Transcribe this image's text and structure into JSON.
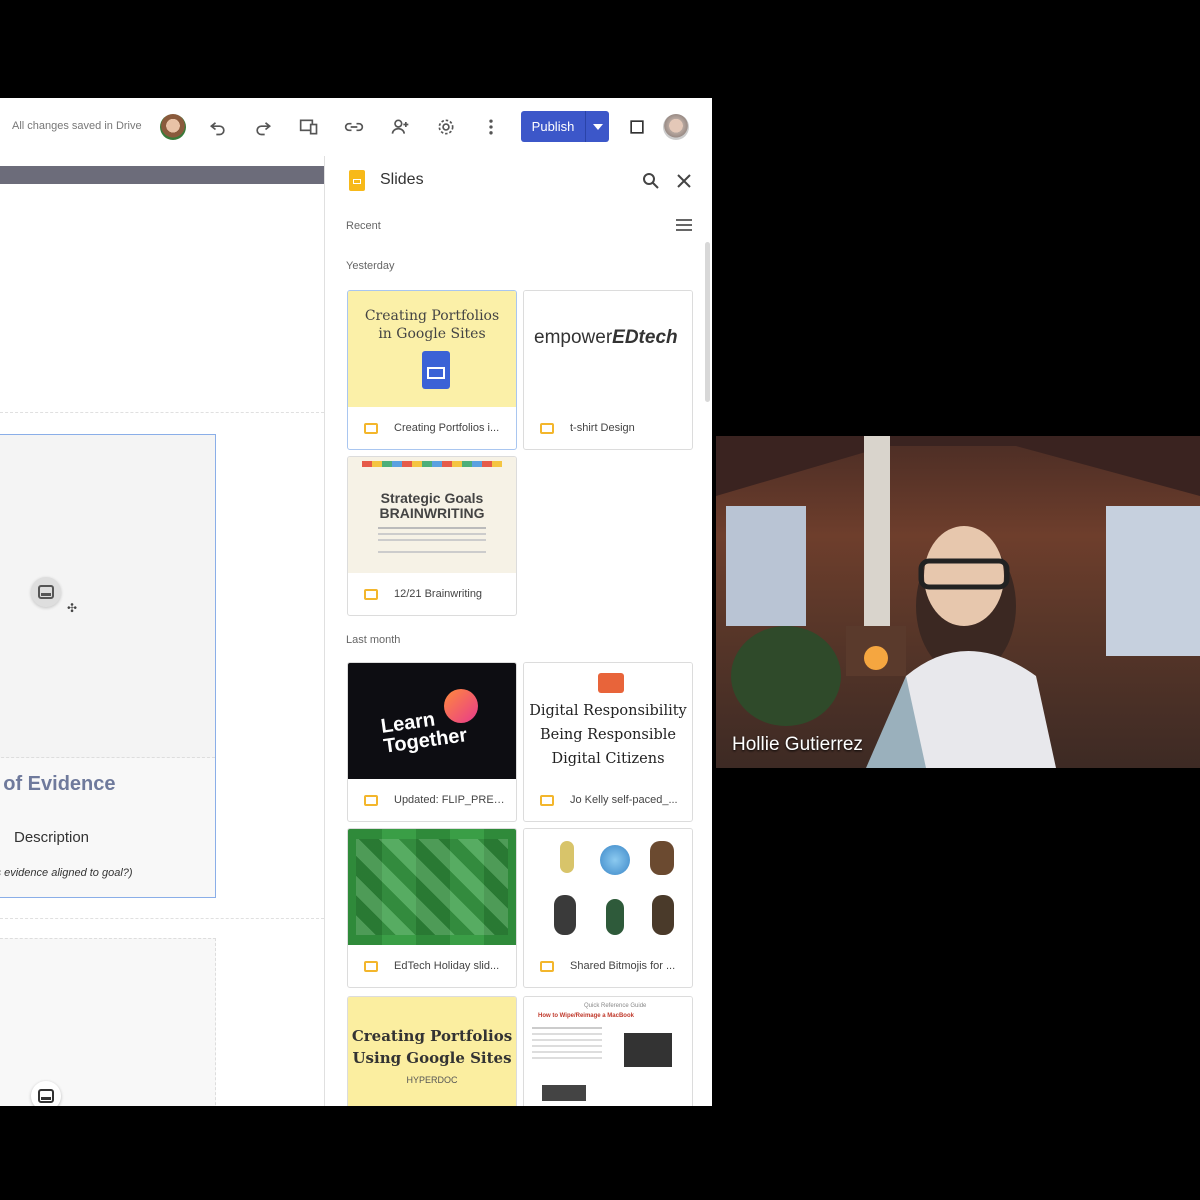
{
  "toolbar": {
    "status": "All changes saved in Drive",
    "publish_label": "Publish"
  },
  "editor": {
    "card_title": "le of Evidence",
    "card_description": "Description",
    "card_question": "his evidence aligned to goal?)"
  },
  "panel": {
    "title": "Slides",
    "recent_label": "Recent",
    "sections": {
      "yesterday": "Yesterday",
      "last_month": "Last month"
    },
    "files": [
      {
        "name": "Creating Portfolios i...",
        "thumb_title": "Creating Portfolios in Google Sites"
      },
      {
        "name": "t-shirt Design",
        "thumb_text_a": "empower",
        "thumb_text_b": "EDtech"
      },
      {
        "name": "12/21 Brainwriting",
        "thumb_title_a": "Strategic Goals",
        "thumb_title_b": "BRAINWRITING"
      },
      {
        "name": "Updated: FLIP_PRES...",
        "thumb_title_a": "Learn",
        "thumb_title_b": "Together"
      },
      {
        "name": "Jo Kelly self-paced_...",
        "thumb_title_a": "Digital Responsibility",
        "thumb_title_b": "Being Responsible",
        "thumb_title_c": "Digital Citizens"
      },
      {
        "name": "EdTech Holiday slid..."
      },
      {
        "name": "Shared Bitmojis for ..."
      },
      {
        "name": "",
        "thumb_title_a": "Creating Portfolios",
        "thumb_title_b": "Using Google Sites",
        "thumb_sub": "HYPERDOC"
      },
      {
        "name": "",
        "thumb_title": "How to Wipe/Reimage a MacBook",
        "thumb_sub": "Quick Reference Guide"
      }
    ]
  },
  "video": {
    "participant_name": "Hollie Gutierrez"
  }
}
